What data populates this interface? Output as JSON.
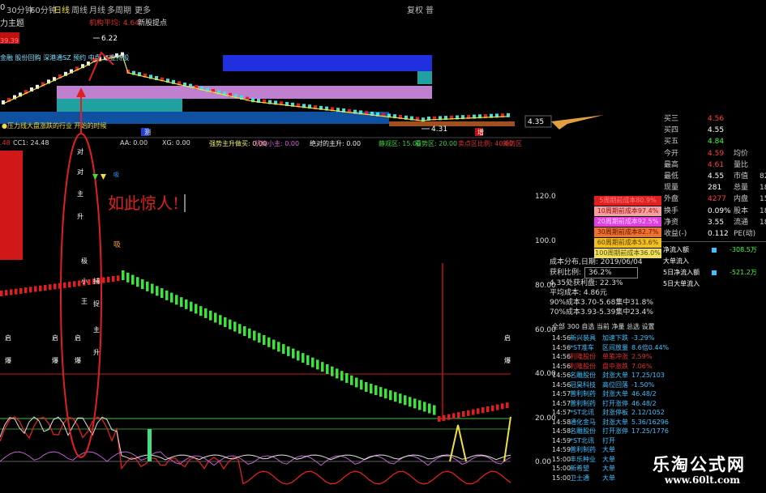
{
  "topbar": {
    "period_tabs": [
      "0",
      "30分钟",
      "60分钟",
      "日线",
      "周线",
      "月线",
      "多周期",
      "更多"
    ],
    "right_items": [
      "复权",
      "普"
    ],
    "title_fragment": "力主题",
    "cost_label": "机构平均: 4.64",
    "new_high_label": "新股提点"
  },
  "kline": {
    "price_high": "6.22",
    "price_low": "4.31",
    "price_current": "4.35",
    "label_left": "39.39",
    "tags_line": "金融 股份回购 深港通SZ 预约 中盘 证金持股",
    "bottom_caption": "●压力线大盘涨跌的行业 开始的时候",
    "markers": [
      "测",
      "增"
    ]
  },
  "indicator": {
    "header_items": [
      {
        "text": ".48",
        "color": "#e03030"
      },
      {
        "text": "CC1: 24.48",
        "color": "#dddddd"
      },
      {
        "text": "AA: 0.00",
        "color": "#dddddd"
      },
      {
        "text": "XG: 0.00",
        "color": "#dddddd"
      },
      {
        "text": "强势主升做买: 0.00",
        "color": "#f0f060"
      },
      {
        "text": "机构小主: 0.00",
        "color": "#e060e0"
      },
      {
        "text": "绝对的主升: 0.00",
        "color": "#f0f0f0"
      },
      {
        "text": "静观区: 15.00",
        "color": "#40d040"
      },
      {
        "text": "看势区: 20.00",
        "color": "#40d040"
      },
      {
        "text": "卖点区比例: 40.00",
        "color": "#e03030"
      },
      {
        "text": "新防区",
        "color": "#e03030"
      }
    ],
    "y_ticks": [
      "120.0",
      "100.0",
      "80.00",
      "60.00",
      "40.00",
      "20.00",
      "0.00"
    ],
    "annotation": "如此惊人!",
    "vertical_text_left": [
      "对",
      "主",
      "升"
    ],
    "vertical_text_small": [
      "极",
      "小",
      "王"
    ],
    "vertical_text_right": [
      "捕",
      "捉"
    ],
    "vertical_text_right2": [
      "主",
      "升"
    ],
    "side_labels": [
      "启",
      "启",
      "启",
      "启"
    ],
    "side_labels2": [
      "爆",
      "爆",
      "爆",
      "爆"
    ],
    "small_labels": [
      "吸",
      "吸"
    ]
  },
  "quote": {
    "rows": [
      {
        "label": "买三",
        "value": "4.56",
        "value_color": "#ff4040",
        "extra": "",
        "extra2": ""
      },
      {
        "label": "买四",
        "value": "4.55",
        "value_color": "#ffffff",
        "extra": "",
        "extra2": ""
      },
      {
        "label": "买五",
        "value": "4.84",
        "value_color": "#40ff40",
        "extra": "",
        "extra2": ""
      },
      {
        "label": "今开",
        "value": "4.59",
        "value_color": "#ff4040",
        "extra": "均价",
        "extra2": ""
      },
      {
        "label": "最高",
        "value": "4.61",
        "value_color": "#ff4040",
        "extra": "量比",
        "extra2": ""
      },
      {
        "label": "最低",
        "value": "4.55",
        "value_color": "#ffffff",
        "extra": "市值",
        "extra2": "82"
      },
      {
        "label": "现量",
        "value": "281",
        "value_color": "#ffffff",
        "extra": "总量",
        "extra2": "18"
      },
      {
        "label": "外盘",
        "value": "4277",
        "value_color": "#ff4040",
        "extra": "内盘",
        "extra2": "15"
      },
      {
        "label": "换手",
        "value": "0.09%",
        "value_color": "#ffffff",
        "extra": "股本",
        "extra2": "18"
      },
      {
        "label": "净资",
        "value": "3.55",
        "value_color": "#ffffff",
        "extra": "流通",
        "extra2": "18"
      },
      {
        "label": "收益(-)",
        "value": "0.112",
        "value_color": "#ffffff",
        "extra": "PE(动)",
        "extra2": ""
      }
    ],
    "flows": [
      {
        "label": "净流入额",
        "value": "-308.5万"
      },
      {
        "label": "大单流入",
        "value": ""
      },
      {
        "label": "5日净流入额",
        "value": "-521.2万"
      },
      {
        "label": "5日大单流入",
        "value": ""
      }
    ]
  },
  "cost_ladder": [
    {
      "text": "5周期前成本80.9%",
      "color": "#e02020",
      "fg": "#ff8080"
    },
    {
      "text": "10周期前成本97.4%",
      "color": "#f4a0a0",
      "fg": "#a01010"
    },
    {
      "text": "20周期前成本92.5%",
      "color": "#e040e0",
      "fg": "#ffd0ff"
    },
    {
      "text": "30周期前成本82.7%",
      "color": "#f07030",
      "fg": "#5a1a00"
    },
    {
      "text": "60周期前成本53.6%",
      "color": "#f0c020",
      "fg": "#5a3a00"
    },
    {
      "text": "100周期前成本36.0%",
      "color": "#f0e060",
      "fg": "#5a4a00"
    }
  ],
  "chip": {
    "date_line": "成本分布,日期: 2019/06/04",
    "profit_label": "获利比例:",
    "profit_value": "36.2%",
    "profit_line": "4.35处获利盘: 22.3%",
    "avg_cost": "平均成本: 4.86元",
    "cost90": "90%成本3.70-5.68集中31.8%",
    "cost70": "70%成本3.93-5.39集中23.4%"
  },
  "trades_tabs": [
    "全部",
    "300",
    "自选",
    "当前",
    "净量",
    "总选",
    "设置"
  ],
  "trades": [
    {
      "time": "14:56",
      "name": "新兴装具",
      "action": "加速下跌",
      "val": "-3.29%",
      "color": "#40c0ff"
    },
    {
      "time": "14:56",
      "name": "*ST准车",
      "action": "区间放量",
      "val": "8.6倍0.44%",
      "color": "#40c0ff"
    },
    {
      "time": "14:56",
      "name": "利隆股份",
      "action": "单笔冲涨",
      "val": "2.59%",
      "color": "#e03030"
    },
    {
      "time": "14:56",
      "name": "利隆股份",
      "action": "盘中涨跌",
      "val": "7.06%",
      "color": "#e03030"
    },
    {
      "time": "14:56",
      "name": "名雕股份",
      "action": "封涨大单",
      "val": "17.25/103",
      "color": "#40c0ff"
    },
    {
      "time": "14:56",
      "name": "冠昊科技",
      "action": "高位回落",
      "val": "-1.50%",
      "color": "#40c0ff"
    },
    {
      "time": "14:57",
      "name": "普利制药",
      "action": "封涨大单",
      "val": "46.48/2",
      "color": "#40c0ff"
    },
    {
      "time": "14:57",
      "name": "普利制药",
      "action": "打开涨停",
      "val": "46.48/2",
      "color": "#40c0ff"
    },
    {
      "time": "14:57",
      "name": "*ST北讯",
      "action": "封涨停板",
      "val": "2.12/1052",
      "color": "#40c0ff"
    },
    {
      "time": "14:58",
      "name": "通化金马",
      "action": "封涨大单",
      "val": "5.36/16296",
      "color": "#40c0ff"
    },
    {
      "time": "14:58",
      "name": "名雕股份",
      "action": "打开涨停",
      "val": "17.25/1776",
      "color": "#40c0ff"
    },
    {
      "time": "14:59",
      "name": "*ST北讯",
      "action": "打开",
      "val": "",
      "color": "#40c0ff"
    },
    {
      "time": "14:59",
      "name": "普利制药",
      "action": "大单",
      "val": "",
      "color": "#40c0ff"
    },
    {
      "time": "15:00",
      "name": "丰乐种业",
      "action": "大单",
      "val": "",
      "color": "#40c0ff"
    },
    {
      "time": "15:00",
      "name": "新希望",
      "action": "大单",
      "val": "",
      "color": "#40c0ff"
    },
    {
      "time": "15:00",
      "name": "卫士通",
      "action": "大单",
      "val": "",
      "color": "#40c0ff"
    }
  ],
  "watermark": {
    "cn": "乐淘公式网",
    "url": "www.60lt.com"
  },
  "colors": {
    "red_line": "#e02020",
    "green_bar": "#40e040",
    "yellow": "#f0e040",
    "blue_bar": "#2040d0",
    "violet_bar": "#c080d0",
    "teal_bar": "#20a0a0",
    "navy_bar": "#1050a0"
  }
}
